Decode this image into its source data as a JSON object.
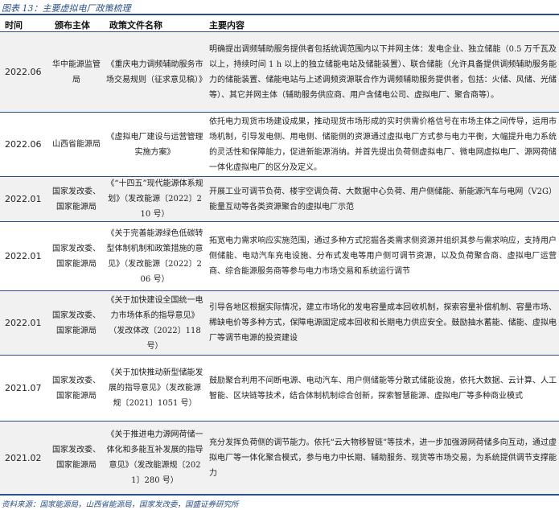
{
  "caption": "图表 13：主要虚拟电厂政策梳理",
  "columns": [
    "时间",
    "颁布主体",
    "政策文件名称",
    "主要内容"
  ],
  "rows": [
    {
      "time": "2022.06",
      "issuer": "华中能源监管局",
      "policy": "《重庆电力调频辅助服务市场交易规则（征求意见稿）》",
      "content": "明确提出调频辅助服务提供者包括统调范围内以下并网主体：发电企业、独立储能（0.5 万千瓦及以上，持续时间 1 h 以上的独立储能电站及储能装置）、联合储能（允许具备提供调频辅助服务能力的储能装置、储能电站与上述调频资源联合作为调频辅助服务提供者，包括：火储、风储、光储等）、其它并网主体（辅助服务供应商、用户含储电公司、虚拟电厂、聚合商等）。"
    },
    {
      "time": "2022.06",
      "issuer": "山西省能源局",
      "policy": "《虚拟电厂建设与运营管理实施方案》",
      "content": "依托电力现货市场建设成果，推动现货市场形成的实时供需价格信号在市场主体之间传导，运用市场机制，引导发电侧、用电侧、储能侧的资源通过虚拟电厂方式参与电力平衡，大幅提升电力系统的灵活性和保障能力，促进新能源消纳。并首先提出负荷侧虚拟电厂、微电网虚拟电厂、源网荷储一体化虚拟电厂的区分及定义。"
    },
    {
      "time": "2022.01",
      "issuer": "国家发改委、国家能源局",
      "policy": "《“十四五”现代能源体系规划》（发改能源〔2022〕210 号）",
      "content": "开展工业可调节负荷、楼宇空调负荷、大数据中心负荷、用户侧储能、新能源汽车与电网（V2G）能量互动等各类资源聚合的虚拟电厂示范"
    },
    {
      "time": "2022.01",
      "issuer": "国家发改委、国家能源局",
      "policy": "《关于完善能源绿色低碳转型体制机制和政策措施的意见》（发改能源〔2022〕206 号）",
      "content": "拓宽电力需求响应实施范围，通过多种方式挖掘各类需求侧资源并组织其参与需求响应，支持用户侧储能、电动汽车充电设施、分布式发电等用户侧可调节资源，以及负荷聚合商、虚拟电厂运营商、综合能源服务商等参与电力市场交易和系统运行调节"
    },
    {
      "time": "2022.01",
      "issuer": "国家发改委、国家能源局",
      "policy": "《关于加快建设全国统一电力市场体系的指导意见》（发改体改〔2022〕118 号）",
      "content": "引导各地区根据实际情况，建立市场化的发电容量成本回收机制，探索容量补偿机制、容量市场、稀缺电价等多种方式，保障电源固定成本回收和长期电力供应安全。鼓励抽水蓄能、储能、虚拟电厂等调节电源的投资建设"
    },
    {
      "time": "2021.07",
      "issuer": "国家发改委、国家能源局",
      "policy": "《关于加快推动新型储能发展的指导意见》（发改能源规〔2021〕1051 号）",
      "content": "鼓励聚合利用不间断电源、电动汽车、用户侧储能等分散式储能设施，依托大数据、云计算、人工智能、区块链等技术，结合体制机制综合创新，探索智慧能源、虚拟电厂等多种商业模式"
    },
    {
      "time": "2021.02",
      "issuer": "国家发改委、国家能源局",
      "policy": "《关于推进电力源网荷储一体化和多能互补发展的指导意见》（发改能源规〔2021〕280 号）",
      "content": "充分发挥负荷侧的调节能力。依托“云大物移智链”等技术，进一步加强源网荷储多向互动，通过虚拟电厂等一体化聚合模式，参与电力中长期、辅助服务、现货等市场交易，为系统提供调节支撑能力"
    }
  ],
  "footer": "资料来源：国家能源局，山西省能源局，国家发改委，国盛证券研究所",
  "colors": {
    "accent": "#2b4f8c",
    "shade": "#f1f1f1"
  }
}
